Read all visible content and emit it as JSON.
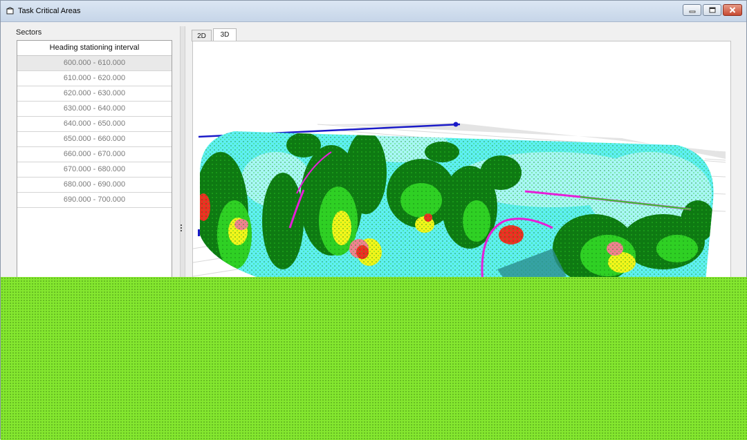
{
  "window": {
    "title": "Task Critical Areas",
    "controls": [
      "minimize-icon",
      "maximize-icon",
      "close-icon"
    ]
  },
  "sidebar": {
    "label": "Sectors",
    "column_header": "Heading stationing interval",
    "rows": [
      "600.000 - 610.000",
      "610.000 - 620.000",
      "620.000 - 630.000",
      "630.000 - 640.000",
      "640.000 - 650.000",
      "650.000 - 660.000",
      "660.000 - 670.000",
      "670.000 - 680.000",
      "680.000 - 690.000",
      "690.000 - 700.000"
    ],
    "selected_index": 0
  },
  "tabs": [
    {
      "label": "2D",
      "active": false
    },
    {
      "label": "3D",
      "active": true
    }
  ],
  "colors": {
    "overlay": "#84e72f",
    "heat_cyan": "#5ef0f2",
    "heat_light": "#a8f7f5",
    "heat_green": "#0e7a12",
    "heat_lime": "#2fd024",
    "heat_yellow": "#f2f51a",
    "heat_red": "#ef2d22",
    "heat_pink": "#f28090",
    "heat_magenta": "#e61ed8",
    "axis_line": "#1a1ac8"
  }
}
